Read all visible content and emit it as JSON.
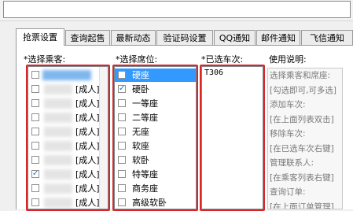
{
  "tabs": [
    "抢票设置",
    "查询起售",
    "最新动态",
    "验证码设置",
    "QQ通知",
    "邮件通知",
    "飞信通知"
  ],
  "headers": {
    "passengers": "*选择乘客:",
    "seats": "*选择席位:",
    "trains": "*已选车次:",
    "help": "使用说明:"
  },
  "passengers": [
    {
      "label": "",
      "checked": false,
      "selected": true
    },
    {
      "label": "[成人]",
      "checked": false
    },
    {
      "label": "[成人]",
      "checked": false
    },
    {
      "label": "[成人]",
      "checked": false
    },
    {
      "label": "[成人]",
      "checked": false
    },
    {
      "label": "[成人]",
      "checked": false
    },
    {
      "label": "[成人]",
      "checked": false
    },
    {
      "label": "[成人]",
      "checked": true
    },
    {
      "label": "[成人]",
      "checked": false
    },
    {
      "label": "[成人]",
      "checked": false
    }
  ],
  "seats": [
    {
      "label": "硬座",
      "checked": false,
      "selected": true
    },
    {
      "label": "硬卧",
      "checked": true
    },
    {
      "label": "一等座",
      "checked": false
    },
    {
      "label": "二等座",
      "checked": false
    },
    {
      "label": "无座",
      "checked": false
    },
    {
      "label": "软座",
      "checked": false
    },
    {
      "label": "软卧",
      "checked": false
    },
    {
      "label": "特等座",
      "checked": false
    },
    {
      "label": "商务座",
      "checked": false
    },
    {
      "label": "高级软卧",
      "checked": false
    }
  ],
  "trains": [
    "T306"
  ],
  "help_lines": [
    "选择乘客和席座:",
    "[勾选即可,可多选]",
    "添加车次:",
    "[在上面列表双击]",
    "移除车次:",
    "[在已选车次右键]",
    "管理联系人:",
    "[在乘客列表右键]",
    "查询订单:",
    "[在上面订单管理]"
  ]
}
